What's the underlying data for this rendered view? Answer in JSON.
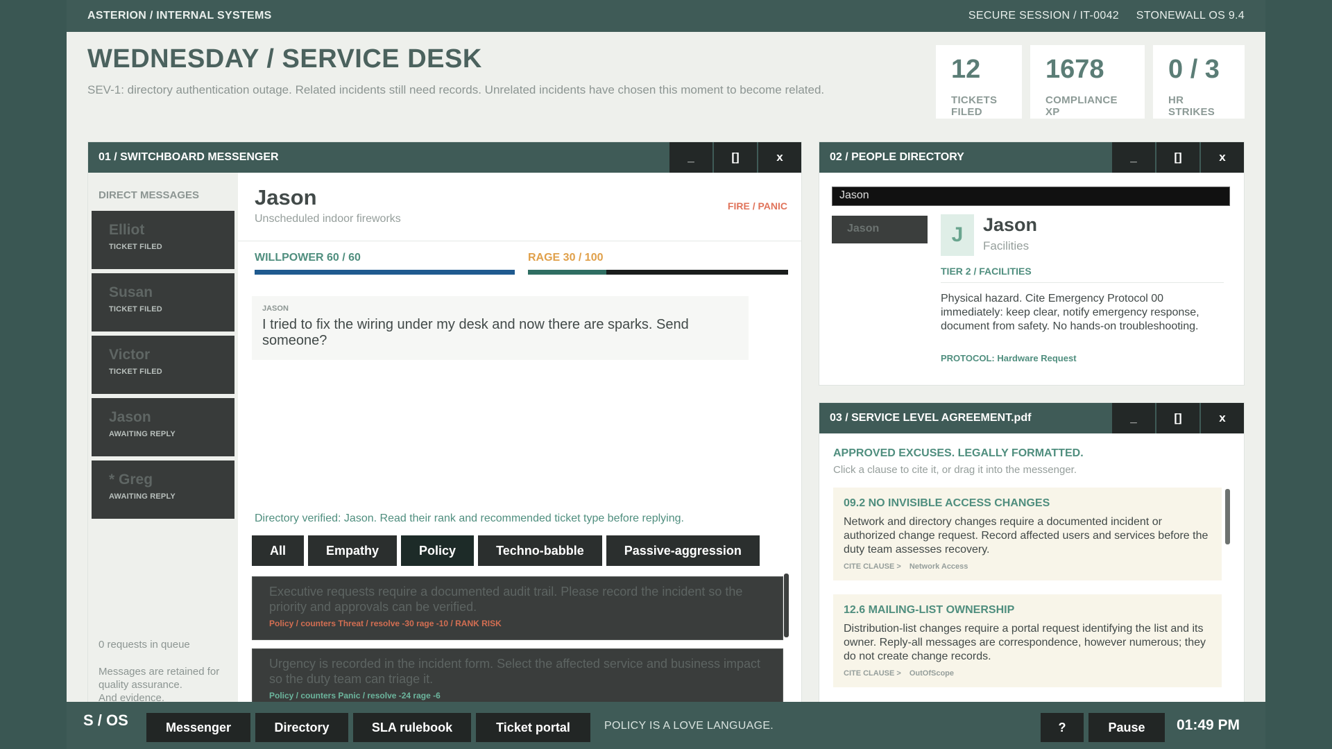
{
  "topbar": {
    "breadcrumb": "ASTERION  /  INTERNAL SYSTEMS",
    "session": "SECURE SESSION  /  IT-0042",
    "os": "STONEWALL OS  9.4"
  },
  "header": {
    "title": "WEDNESDAY / SERVICE DESK",
    "subtitle": "SEV-1: directory authentication outage. Related incidents still need records. Unrelated incidents have chosen this moment to become related."
  },
  "stats": [
    {
      "value": "12",
      "label": "TICKETS FILED"
    },
    {
      "value": "1678",
      "label": "COMPLIANCE XP"
    },
    {
      "value": "0 / 3",
      "label": "HR STRIKES"
    }
  ],
  "window_controls": {
    "minimize": "_",
    "maximize": "[]",
    "close": "x"
  },
  "messenger": {
    "title": "01  /  SWITCHBOARD MESSENGER",
    "sidebar_header": "DIRECT MESSAGES",
    "contacts": [
      {
        "name": "Elliot",
        "status": "TICKET FILED"
      },
      {
        "name": "Susan",
        "status": "TICKET FILED"
      },
      {
        "name": "Victor",
        "status": "TICKET FILED"
      },
      {
        "name": "Jason",
        "status": "AWAITING REPLY"
      },
      {
        "name": "* Greg",
        "status": "AWAITING REPLY"
      }
    ],
    "queue": "0 requests in queue",
    "retention": "Messages are retained for quality assurance.\nAnd evidence.",
    "chat": {
      "name": "Jason",
      "subtitle": "Unscheduled indoor fireworks",
      "tag": "FIRE  /  PANIC",
      "willpower_label": "WILLPOWER   60 / 60",
      "willpower_fraction": 1.0,
      "rage_label": "RAGE   30 / 100",
      "rage_fraction": 0.3,
      "message_from": "JASON",
      "message_text": "I tried to fix the wiring under my desk and now there are sparks. Send someone?",
      "verified": "Directory verified: Jason. Read their rank and recommended ticket type before replying."
    },
    "filters": [
      "All",
      "Empathy",
      "Policy",
      "Techno-babble",
      "Passive-aggression"
    ],
    "replies": [
      {
        "text": "Executive requests require a documented audit trail. Please record the incident so the priority and approvals can be verified.",
        "meta": "Policy  /  counters Threat  /  resolve -30  rage -10  /  RANK RISK"
      },
      {
        "text": "Urgency is recorded in the incident form. Select the affected service and business impact so the duty team can triage it.",
        "meta": "Policy  /  counters Panic  /  resolve -24  rage -6"
      }
    ]
  },
  "directory": {
    "title": "02  /  PEOPLE DIRECTORY",
    "search_value": "Jason",
    "result_button": "Jason",
    "avatar_initial": "J",
    "name": "Jason",
    "department": "Facilities",
    "tier": "TIER 2  /  FACILITIES",
    "note": "Physical hazard. Cite Emergency Protocol 00 immediately: keep clear, notify emergency response, document from safety. No hands-on troubleshooting.",
    "protocol": "PROTOCOL: Hardware Request"
  },
  "sla": {
    "title": "03  /  SERVICE LEVEL AGREEMENT.pdf",
    "heading": "APPROVED EXCUSES. LEGALLY FORMATTED.",
    "instructions": "Click a clause to cite it, or drag it into the messenger.",
    "clauses": [
      {
        "heading": "09.2   NO INVISIBLE ACCESS CHANGES",
        "body": "Network and directory changes require a documented incident or authorized change request. Record affected users and services before the duty team assesses recovery.",
        "cite": "CITE CLAUSE  >",
        "tag": "Network Access"
      },
      {
        "heading": "12.6   MAILING-LIST OWNERSHIP",
        "body": "Distribution-list changes require a portal request identifying the list and its owner. Reply-all messages are correspondence, however numerous; they do not create change records.",
        "cite": "CITE CLAUSE  >",
        "tag": "OutOfScope"
      }
    ]
  },
  "taskbar": {
    "logo": "S / OS",
    "buttons": [
      "Messenger",
      "Directory",
      "SLA rulebook",
      "Ticket portal"
    ],
    "ticker": "POLICY IS A LOVE LANGUAGE.",
    "help": "?",
    "pause": "Pause",
    "clock": "01:49  PM"
  },
  "colors": {
    "header_bg": "#3f5b57",
    "accent": "#4f8e7e",
    "willpower": "#1f5a8f",
    "rage": "#2f6e62",
    "alert": "#e0735a"
  }
}
